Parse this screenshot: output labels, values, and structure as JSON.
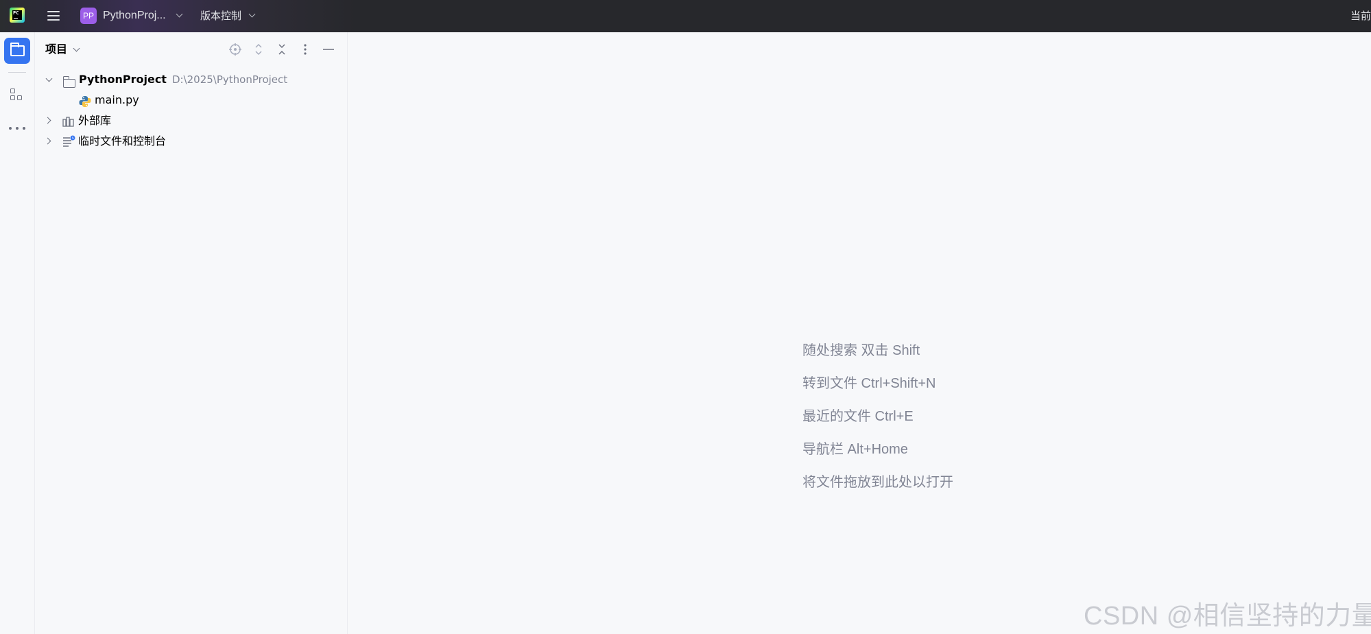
{
  "titlebar": {
    "project_badge": "PP",
    "project_name": "PythonProj...",
    "vcs_label": "版本控制",
    "right_label": "当前"
  },
  "toolstrip": {
    "icons": [
      "project-folder-icon",
      "structure-icon",
      "more-icon"
    ]
  },
  "panel": {
    "title": "项目",
    "toolbar_icons": [
      "locate-icon",
      "expand-all-icon",
      "collapse-all-icon",
      "options-icon",
      "hide-icon"
    ],
    "tree": {
      "root": {
        "name": "PythonProject",
        "path": "D:\\2025\\PythonProject"
      },
      "file": {
        "name": "main.py"
      },
      "external_libs": {
        "name": "外部库"
      },
      "scratches": {
        "name": "临时文件和控制台"
      }
    }
  },
  "editor": {
    "hints": [
      "随处搜索 双击 Shift",
      "转到文件 Ctrl+Shift+N",
      "最近的文件 Ctrl+E",
      "导航栏 Alt+Home",
      "将文件拖放到此处以打开"
    ]
  },
  "watermark": "CSDN @相信坚持的力量",
  "colors": {
    "accent": "#3574f0",
    "badge": "#9c5ee8",
    "titlebar_bg": "#27282c",
    "panel_bg": "#f7f8fa",
    "hint_text": "#818594"
  }
}
